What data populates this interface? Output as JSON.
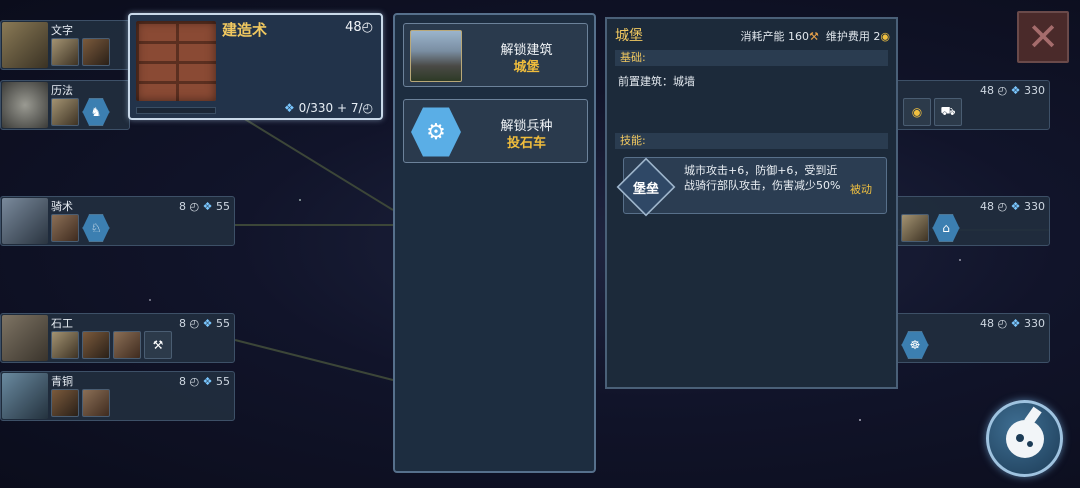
{
  "selected_tech": {
    "name": "建造术",
    "turns": "48",
    "progress": "0/330 + 7/"
  },
  "tree_nodes": [
    {
      "name": "文字",
      "stats": ""
    },
    {
      "name": "历法",
      "stats": ""
    },
    {
      "name": "骑术",
      "turns": "8",
      "science": "55"
    },
    {
      "name": "石工",
      "turns": "8",
      "science": "55"
    },
    {
      "name": "青铜",
      "turns": "8",
      "science": "55"
    },
    {
      "name": "",
      "turns": "48",
      "science": "330"
    },
    {
      "name": "",
      "turns": "48",
      "science": "330"
    },
    {
      "name": "",
      "turns": "48",
      "science": "330"
    }
  ],
  "unlock_panel": {
    "items": [
      {
        "label": "解锁建筑",
        "value": "城堡",
        "icon": "castle-icon"
      },
      {
        "label": "解锁兵种",
        "value": "投石车",
        "icon": "catapult-icon"
      }
    ]
  },
  "info_panel": {
    "title": "城堡",
    "cost_label": "消耗产能",
    "cost_value": "160",
    "upkeep_label": "维护费用",
    "upkeep_value": "2",
    "basic_header": "基础:",
    "prereq": "前置建筑：城墙",
    "skills_header": "技能:",
    "skill": {
      "name": "堡垒",
      "description": "城市攻击+6，防御+6，受到近战骑行部队攻击，伤害减少50%",
      "type": "被动"
    }
  },
  "colors": {
    "accent_gold": "#f0c860",
    "science_blue": "#7ac7ff",
    "panel_bg": "#1c2a3a"
  }
}
